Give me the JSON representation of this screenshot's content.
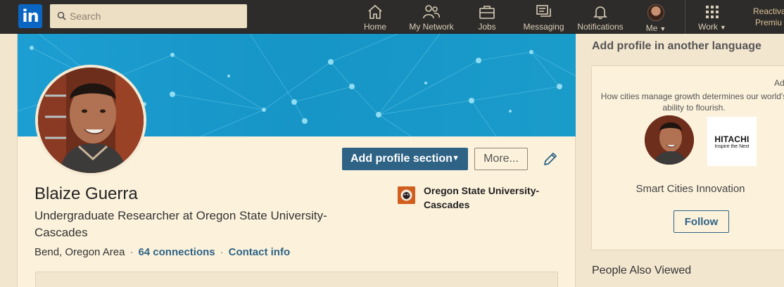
{
  "nav": {
    "logo_text": "in",
    "search_placeholder": "Search",
    "items": [
      {
        "label": "Home",
        "icon": "home-icon"
      },
      {
        "label": "My Network",
        "icon": "network-icon"
      },
      {
        "label": "Jobs",
        "icon": "briefcase-icon"
      },
      {
        "label": "Messaging",
        "icon": "messaging-icon"
      },
      {
        "label": "Notifications",
        "icon": "bell-icon"
      },
      {
        "label": "Me",
        "icon": "avatar"
      },
      {
        "label": "Work",
        "icon": "grid-icon"
      }
    ],
    "premium_line1": "Reactiva",
    "premium_line2": "Premiu"
  },
  "profile": {
    "name": "Blaize Guerra",
    "headline": "Undergraduate Researcher at Oregon State University-Cascades",
    "location": "Bend, Oregon Area",
    "connections": "64 connections",
    "contact": "Contact info",
    "education": "Oregon State University-Cascades",
    "add_section_label": "Add profile section",
    "more_label": "More..."
  },
  "sidebar": {
    "language_heading": "Add profile in another language",
    "ad": {
      "label": "Ad",
      "text": "How cities manage growth determines our world's ability to flourish.",
      "company": "Smart Cities Innovation",
      "logo_brand": "HITACHI",
      "logo_tagline": "Inspire the Next",
      "follow_label": "Follow"
    },
    "people_heading": "People Also Viewed"
  },
  "colors": {
    "nav_bg": "#2d2c2a",
    "page_bg": "#f3e6cf",
    "card_bg": "#fcf2dc",
    "banner": "#1a9ccb",
    "primary_button": "#2e6385",
    "link": "#2e6385"
  }
}
